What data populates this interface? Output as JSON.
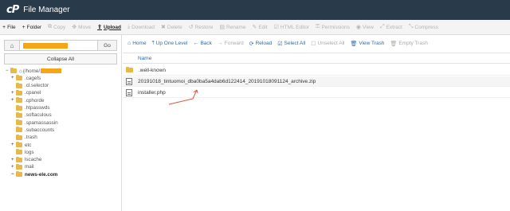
{
  "app": {
    "logo": "cP",
    "title": "File Manager"
  },
  "toolbar": [
    {
      "icon": "plus-icon",
      "glyph": "+",
      "label": "File",
      "enabled": true
    },
    {
      "icon": "plus-icon",
      "glyph": "+",
      "label": "Folder",
      "enabled": true
    },
    {
      "icon": "copy-icon",
      "glyph": "⧉",
      "label": "Copy",
      "enabled": false
    },
    {
      "icon": "move-icon",
      "glyph": "✥",
      "label": "Move",
      "enabled": false
    },
    {
      "icon": "upload-icon",
      "glyph": "⇪",
      "label": "Upload",
      "enabled": true
    },
    {
      "icon": "download-icon",
      "glyph": "⤓",
      "label": "Download",
      "enabled": false
    },
    {
      "icon": "delete-icon",
      "glyph": "✖",
      "label": "Delete",
      "enabled": false
    },
    {
      "icon": "restore-icon",
      "glyph": "↺",
      "label": "Restore",
      "enabled": false
    },
    {
      "icon": "rename-icon",
      "glyph": "▤",
      "label": "Rename",
      "enabled": false
    },
    {
      "icon": "edit-icon",
      "glyph": "✎",
      "label": "Edit",
      "enabled": false
    },
    {
      "icon": "html-editor-icon",
      "glyph": "☑",
      "label": "HTML Editor",
      "enabled": false
    },
    {
      "icon": "permissions-icon",
      "glyph": "⚿",
      "label": "Permissions",
      "enabled": false
    },
    {
      "icon": "view-icon",
      "glyph": "◉",
      "label": "View",
      "enabled": false
    },
    {
      "icon": "extract-icon",
      "glyph": "⤢",
      "label": "Extract",
      "enabled": false
    },
    {
      "icon": "compress-icon",
      "glyph": "⤡",
      "label": "Compress",
      "enabled": false
    }
  ],
  "sidebar": {
    "home_glyph": "⌂",
    "go_label": "Go",
    "collapse_label": "Collapse All",
    "tree": [
      {
        "label": "(/home/",
        "level": 0,
        "expand": "−",
        "redacted": true,
        "home": true,
        "bold": false
      },
      {
        "label": ".cagefs",
        "level": 1,
        "expand": "+",
        "bold": false
      },
      {
        "label": ".cl.selector",
        "level": 1,
        "expand": "",
        "bold": false
      },
      {
        "label": ".cpanel",
        "level": 1,
        "expand": "+",
        "bold": false
      },
      {
        "label": ".cphorde",
        "level": 1,
        "expand": "+",
        "bold": false
      },
      {
        "label": ".htpasswds",
        "level": 1,
        "expand": "",
        "bold": false
      },
      {
        "label": ".softaculous",
        "level": 1,
        "expand": "",
        "bold": false
      },
      {
        "label": ".spamassassin",
        "level": 1,
        "expand": "",
        "bold": false
      },
      {
        "label": ".subaccounts",
        "level": 1,
        "expand": "",
        "bold": false
      },
      {
        "label": ".trash",
        "level": 1,
        "expand": "",
        "bold": false
      },
      {
        "label": "etc",
        "level": 1,
        "expand": "+",
        "bold": false
      },
      {
        "label": "logs",
        "level": 1,
        "expand": "",
        "bold": false
      },
      {
        "label": "lscache",
        "level": 1,
        "expand": "+",
        "bold": false
      },
      {
        "label": "mail",
        "level": 1,
        "expand": "+",
        "bold": false
      },
      {
        "label": "news-ele.com",
        "level": 1,
        "expand": "−",
        "bold": true
      }
    ]
  },
  "navbar": [
    {
      "icon": "home-icon",
      "glyph": "⌂",
      "label": "Home",
      "enabled": true
    },
    {
      "icon": "up-level-icon",
      "glyph": "⤒",
      "label": "Up One Level",
      "enabled": true
    },
    {
      "icon": "back-icon",
      "glyph": "←",
      "label": "Back",
      "enabled": true
    },
    {
      "icon": "forward-icon",
      "glyph": "→",
      "label": "Forward",
      "enabled": false
    },
    {
      "icon": "reload-icon",
      "glyph": "⟳",
      "label": "Reload",
      "enabled": true
    },
    {
      "icon": "select-all-icon",
      "glyph": "☑",
      "label": "Select All",
      "enabled": true
    },
    {
      "icon": "unselect-all-icon",
      "glyph": "☐",
      "label": "Unselect All",
      "enabled": false
    },
    {
      "icon": "trash-icon",
      "glyph": "🗑",
      "label": "View Trash",
      "enabled": true
    },
    {
      "icon": "empty-trash-icon",
      "glyph": "🗑",
      "label": "Empty Trash",
      "enabled": false
    }
  ],
  "files": {
    "column_name": "Name",
    "rows": [
      {
        "name": ".well-known",
        "type": "folder"
      },
      {
        "name": "20191018_tintuomoi_dba0ba5a4dab6d122414_20191018091124_archive.zip",
        "type": "file"
      },
      {
        "name": "installer.php",
        "type": "file"
      }
    ]
  },
  "colors": {
    "titlebar": "#293a4a",
    "link": "#2a6cb5",
    "folder": "#e8b84a",
    "annotation": "#e0533d",
    "redaction": "#f5a516"
  }
}
